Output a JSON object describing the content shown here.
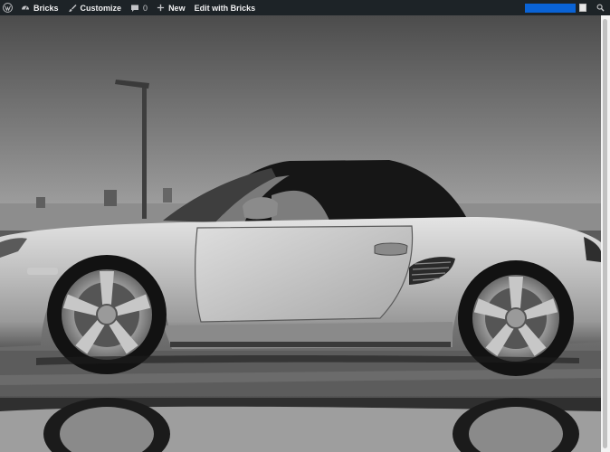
{
  "adminbar": {
    "wp_logo_icon": "wordpress-icon",
    "site_name": "Bricks",
    "site_icon": "dashboard-icon",
    "customize_label": "Customize",
    "customize_icon": "brush-icon",
    "comments_count": "0",
    "comments_icon": "comment-icon",
    "new_label": "New",
    "new_icon": "plus-icon",
    "edit_label": "Edit with Bricks",
    "search_icon": "search-icon",
    "account_color": "#0a63d6"
  },
  "hero": {
    "image": "grayscale silver convertible sports car parked on wet pavement with reflection"
  }
}
